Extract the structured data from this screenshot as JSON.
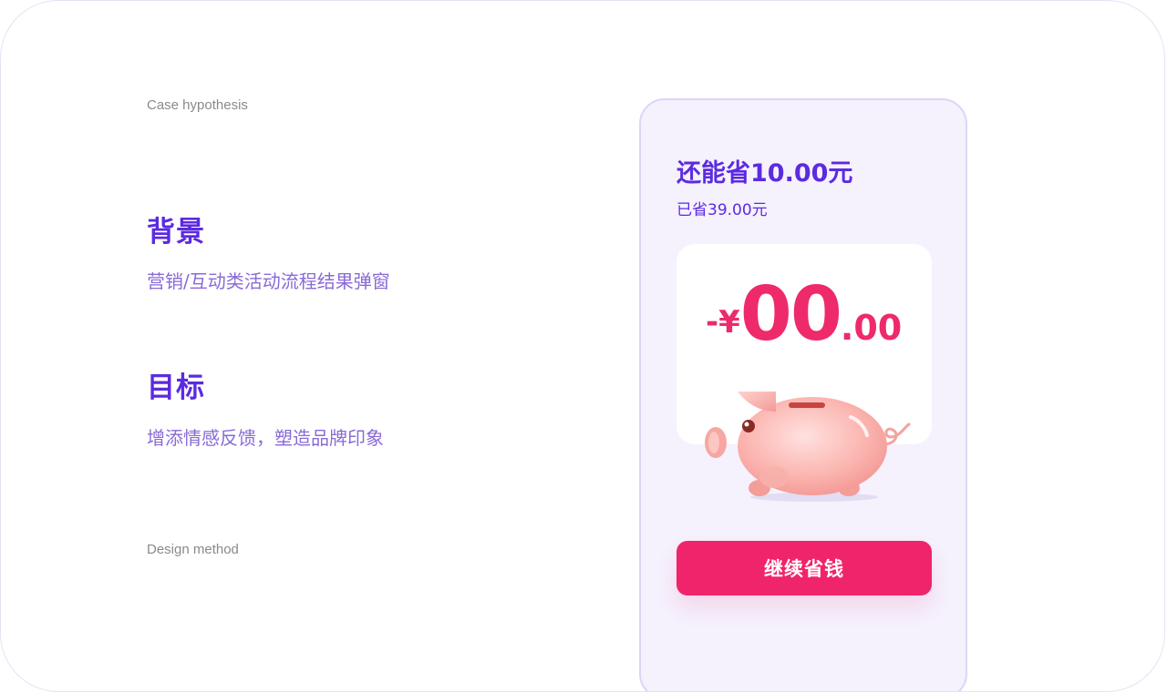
{
  "page": {
    "case_label": "Case hypothesis",
    "method_label": "Design method",
    "background_heading": "背景",
    "background_desc": "营销/互动类活动流程结果弹窗",
    "goal_heading": "目标",
    "goal_desc": "增添情感反馈，塑造品牌印象"
  },
  "popup": {
    "title": "还能省10.00元",
    "subtitle": "已省39.00元",
    "amount_prefix": "-¥",
    "amount_int": "00",
    "amount_dec": ".00",
    "cta_label": "继续省钱",
    "illustration": "piggy-bank-icon"
  },
  "colors": {
    "accent_purple": "#5b2be0",
    "accent_pink": "#f0246a",
    "amount_pink": "#ee2a6b",
    "card_bg": "#f5f1fd"
  }
}
